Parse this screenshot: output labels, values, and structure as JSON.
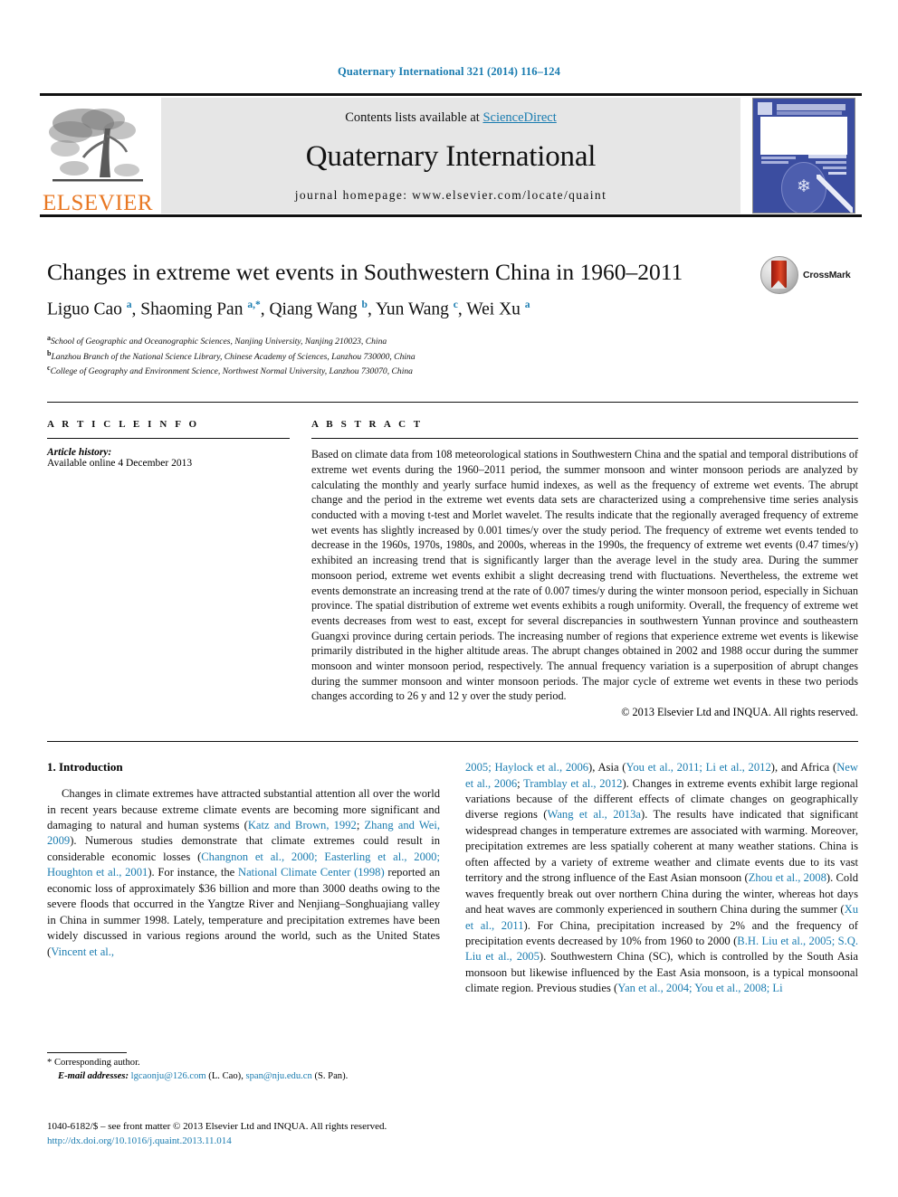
{
  "running_head": "Quaternary International 321 (2014) 116–124",
  "masthead": {
    "contents_prefix": "Contents lists available at ",
    "sciencedirect": "ScienceDirect",
    "journal_title": "Quaternary International",
    "homepage": "journal homepage: www.elsevier.com/locate/quaint",
    "publisher": "ELSEVIER",
    "accent_link": "#1a7cb0",
    "band_bg": "#e6e6e6"
  },
  "article": {
    "title": "Changes in extreme wet events in Southwestern China in 1960–2011",
    "crossmark_label": "CrossMark",
    "authors_html": "Liguo Cao <sup>a</sup>, Shaoming Pan <sup>a,*</sup>, Qiang Wang <sup>b</sup>, Yun Wang <sup>c</sup>, Wei Xu <sup>a</sup>",
    "affiliations": [
      {
        "marker": "a",
        "text": "School of Geographic and Oceanographic Sciences, Nanjing University, Nanjing 210023, China"
      },
      {
        "marker": "b",
        "text": "Lanzhou Branch of the National Science Library, Chinese Academy of Sciences, Lanzhou 730000, China"
      },
      {
        "marker": "c",
        "text": "College of Geography and Environment Science, Northwest Normal University, Lanzhou 730070, China"
      }
    ]
  },
  "article_info": {
    "heading": "A R T I C L E  I N F O",
    "history_label": "Article history:",
    "history_value": "Available online 4 December 2013"
  },
  "abstract": {
    "heading": "A B S T R A C T",
    "text": "Based on climate data from 108 meteorological stations in Southwestern China and the spatial and temporal distributions of extreme wet events during the 1960–2011 period, the summer monsoon and winter monsoon periods are analyzed by calculating the monthly and yearly surface humid indexes, as well as the frequency of extreme wet events. The abrupt change and the period in the extreme wet events data sets are characterized using a comprehensive time series analysis conducted with a moving t-test and Morlet wavelet. The results indicate that the regionally averaged frequency of extreme wet events has slightly increased by 0.001 times/y over the study period. The frequency of extreme wet events tended to decrease in the 1960s, 1970s, 1980s, and 2000s, whereas in the 1990s, the frequency of extreme wet events (0.47 times/y) exhibited an increasing trend that is significantly larger than the average level in the study area. During the summer monsoon period, extreme wet events exhibit a slight decreasing trend with fluctuations. Nevertheless, the extreme wet events demonstrate an increasing trend at the rate of 0.007 times/y during the winter monsoon period, especially in Sichuan province. The spatial distribution of extreme wet events exhibits a rough uniformity. Overall, the frequency of extreme wet events decreases from west to east, except for several discrepancies in southwestern Yunnan province and southeastern Guangxi province during certain periods. The increasing number of regions that experience extreme wet events is likewise primarily distributed in the higher altitude areas. The abrupt changes obtained in 2002 and 1988 occur during the summer monsoon and winter monsoon period, respectively. The annual frequency variation is a superposition of abrupt changes during the summer monsoon and winter monsoon periods. The major cycle of extreme wet events in these two periods changes according to 26 y and 12 y over the study period.",
    "copyright": "© 2013 Elsevier Ltd and INQUA. All rights reserved."
  },
  "introduction": {
    "heading": "1. Introduction",
    "left_paragraph_html": "Changes in climate extremes have attracted substantial attention all over the world in recent years because extreme climate events are becoming more significant and damaging to natural and human systems (<span class=\"cit\">Katz and Brown, 1992</span>; <span class=\"cit\">Zhang and Wei, 2009</span>). Numerous studies demonstrate that climate extremes could result in considerable economic losses (<span class=\"cit\">Changnon et al., 2000; Easterling et al., 2000; Houghton et al., 2001</span>). For instance, the <span class=\"cit\">National Climate Center (1998)</span> reported an economic loss of approximately $36 billion and more than 3000 deaths owing to the severe floods that occurred in the Yangtze River and Nenjiang–Songhuajiang valley in China in summer 1998. Lately, temperature and precipitation extremes have been widely discussed in various regions around the world, such as the United States (<span class=\"cit\">Vincent et al.,</span>",
    "right_paragraph_html": "<span class=\"cit\">2005; Haylock et al., 2006</span>), Asia (<span class=\"cit\">You et al., 2011; Li et al., 2012</span>), and Africa (<span class=\"cit\">New et al., 2006</span>; <span class=\"cit\">Tramblay et al., 2012</span>). Changes in extreme events exhibit large regional variations because of the different effects of climate changes on geographically diverse regions (<span class=\"cit\">Wang et al., 2013a</span>). The results have indicated that significant widespread changes in temperature extremes are associated with warming. Moreover, precipitation extremes are less spatially coherent at many weather stations. China is often affected by a variety of extreme weather and climate events due to its vast territory and the strong influence of the East Asian monsoon (<span class=\"cit\">Zhou et al., 2008</span>). Cold waves frequently break out over northern China during the winter, whereas hot days and heat waves are commonly experienced in southern China during the summer (<span class=\"cit\">Xu et al., 2011</span>). For China, precipitation increased by 2% and the frequency of precipitation events decreased by 10% from 1960 to 2000 (<span class=\"cit\">B.H. Liu et al., 2005; S.Q. Liu et al., 2005</span>). Southwestern China (SC), which is controlled by the South Asia monsoon but likewise influenced by the East Asia monsoon, is a typical monsoonal climate region. Previous studies (<span class=\"cit\">Yan et al., 2004; You et al., 2008; Li</span>"
  },
  "footnote": {
    "corresponding": "* Corresponding author.",
    "email_label": "E-mail addresses:",
    "email_1": "lgcaonju@126.com",
    "email_1_who": " (L. Cao), ",
    "email_2": "span@nju.edu.cn",
    "email_2_who": " (S. Pan)."
  },
  "footer": {
    "issn_line": "1040-6182/$ – see front matter © 2013 Elsevier Ltd and INQUA. All rights reserved.",
    "doi": "http://dx.doi.org/10.1016/j.quaint.2013.11.014"
  }
}
